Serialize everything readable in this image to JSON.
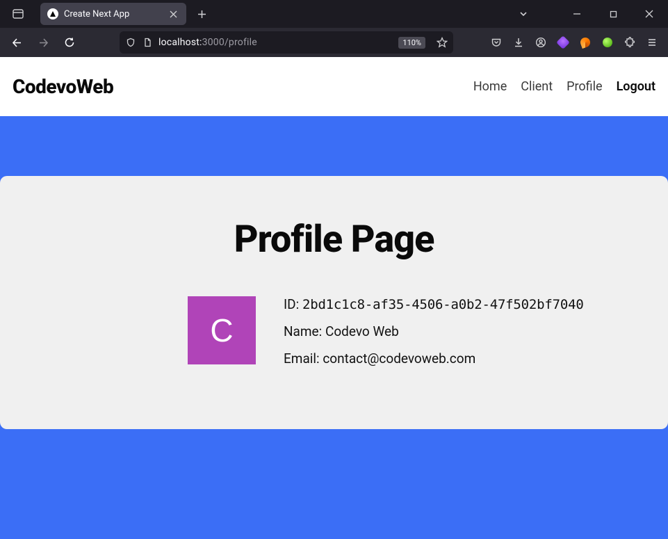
{
  "browser": {
    "tab_title": "Create Next App",
    "url_host": "localhost:",
    "url_path": "3000/profile",
    "zoom": "110%"
  },
  "header": {
    "brand": "CodevoWeb",
    "nav": {
      "home": "Home",
      "client": "Client",
      "profile": "Profile",
      "logout": "Logout"
    }
  },
  "page": {
    "title": "Profile Page",
    "avatar_initial": "C",
    "fields": {
      "id_label": "ID:",
      "id_value": "2bd1c1c8-af35-4506-a0b2-47f502bf7040",
      "name_label": "Name:",
      "name_value": "Codevo Web",
      "email_label": "Email:",
      "email_value": "contact@codevoweb.com"
    }
  }
}
